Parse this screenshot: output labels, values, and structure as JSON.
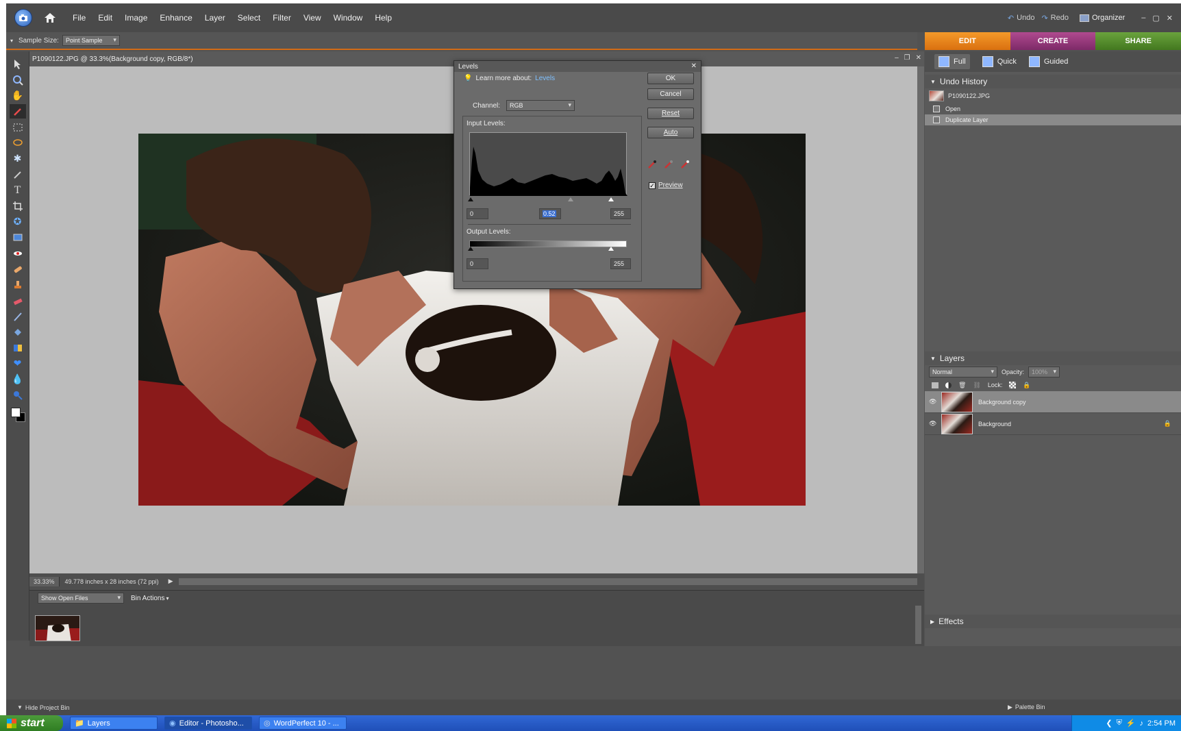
{
  "menubar": {
    "menus": [
      "File",
      "Edit",
      "Image",
      "Enhance",
      "Layer",
      "Select",
      "Filter",
      "View",
      "Window",
      "Help"
    ],
    "undo_label": "Undo",
    "redo_label": "Redo",
    "organizer_label": "Organizer"
  },
  "options_bar": {
    "sample_size_label": "Sample Size:",
    "sample_size_value": "Point Sample"
  },
  "mode_tabs": {
    "edit": "EDIT",
    "create": "CREATE",
    "share": "SHARE"
  },
  "edit_modes": {
    "full": "Full",
    "quick": "Quick",
    "guided": "Guided"
  },
  "document": {
    "title": "P1090122.JPG @ 33.3%(Background copy, RGB/8*)",
    "zoom": "33.33%",
    "doc_info": "49.778 inches x 28 inches (72 ppi)"
  },
  "project_bin": {
    "show_label": "Show Open Files",
    "bin_actions": "Bin Actions",
    "hide_label": "Hide Project Bin"
  },
  "undo_history": {
    "title": "Undo History",
    "file": "P1090122.JPG",
    "items": [
      "Open",
      "Duplicate Layer"
    ]
  },
  "layers_panel": {
    "title": "Layers",
    "blend_mode": "Normal",
    "opacity_label": "Opacity:",
    "opacity_value": "100%",
    "lock_label": "Lock:",
    "layers": [
      "Background copy",
      "Background"
    ]
  },
  "effects_panel": {
    "title": "Effects"
  },
  "palette_bin_label": "Palette Bin",
  "levels_dialog": {
    "title": "Levels",
    "learn_more": "Learn more about:",
    "learn_link": "Levels",
    "ok": "OK",
    "cancel": "Cancel",
    "reset": "Reset",
    "auto": "Auto",
    "channel_label": "Channel:",
    "channel_value": "RGB",
    "input_levels_label": "Input Levels:",
    "input_black": "0",
    "input_gamma": "0.52",
    "input_white": "255",
    "output_levels_label": "Output Levels:",
    "output_black": "0",
    "output_white": "255",
    "preview_label": "Preview"
  },
  "taskbar": {
    "start": "start",
    "items": [
      "Layers",
      "Editor - Photosho...",
      "WordPerfect 10 - ..."
    ],
    "clock": "2:54 PM"
  }
}
